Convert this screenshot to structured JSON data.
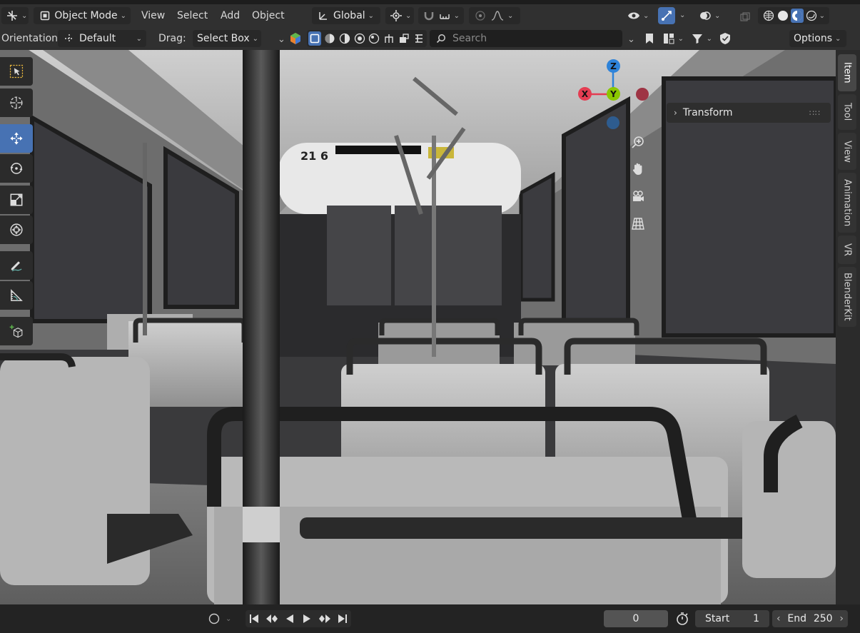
{
  "header": {
    "mode_label": "Object Mode",
    "menus": [
      "View",
      "Select",
      "Add",
      "Object"
    ],
    "transform_orientation": "Global"
  },
  "tool_header": {
    "orientation_label": "Orientation:",
    "orientation_value": "Default",
    "drag_label": "Drag:",
    "drag_value": "Select Box",
    "search_placeholder": "Search",
    "options_label": "Options"
  },
  "sidebar": {
    "tabs": [
      "Item",
      "Tool",
      "View",
      "Animation",
      "VR",
      "BlenderKit"
    ],
    "active_tab": "Item",
    "panel_title": "Transform"
  },
  "gizmo": {
    "x": "X",
    "y": "Y",
    "z": "Z"
  },
  "scene": {
    "bus_number": "21 6"
  },
  "timeline": {
    "current_frame": "0",
    "start_label": "Start",
    "start_value": "1",
    "end_label": "End",
    "end_value": "250"
  },
  "colors": {
    "accent": "#4772b3",
    "axis_x": "#e43d52",
    "axis_y": "#8bc700",
    "axis_z": "#2e83d9"
  }
}
